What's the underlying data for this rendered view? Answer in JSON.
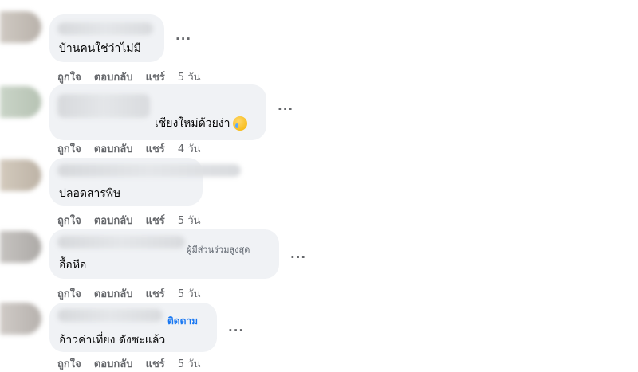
{
  "actions": {
    "like": "ถูกใจ",
    "reply": "ตอบกลับ",
    "share": "แชร์"
  },
  "more_label": "···",
  "comments": [
    {
      "text": "บ้านคนใช่ว่าไม่มี",
      "time": "5 วัน"
    },
    {
      "text": "เชียงใหม่ด้วยง่า",
      "time": "4 วัน"
    },
    {
      "text": "ปลอดสารพิษ",
      "time": "5 วัน"
    },
    {
      "badge": "ผู้มีส่วนร่วมสูงสุด",
      "text": "อื้อหือ",
      "time": "5 วัน"
    },
    {
      "follow": "ติดตาม",
      "text": "อ้าวค่าเที่ยง ดังซะแล้ว",
      "time": "5 วัน"
    }
  ]
}
